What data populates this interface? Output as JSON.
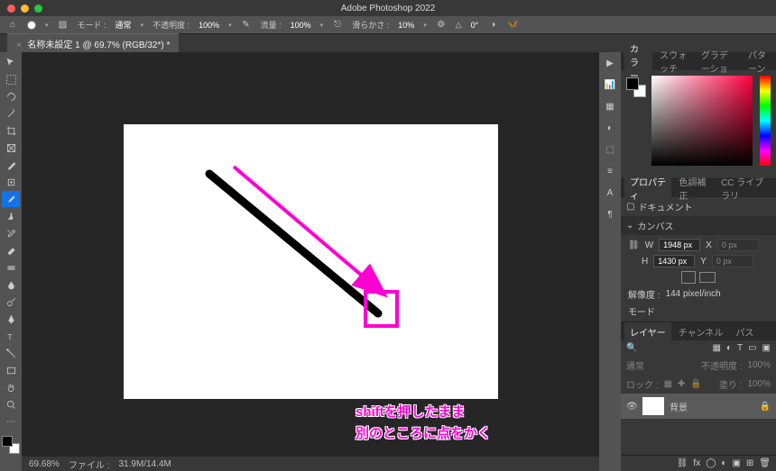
{
  "app": {
    "title": "Adobe Photoshop 2022"
  },
  "tab": {
    "close": "×",
    "name": "名称未設定 1 @ 69.7% (RGB/32*) *"
  },
  "optbar": {
    "home": "⌂",
    "mode_lbl": "モード :",
    "mode_val": "通常",
    "opacity_lbl": "不透明度 :",
    "opacity_val": "100%",
    "flow_lbl": "流量 :",
    "flow_val": "100%",
    "smooth_lbl": "滑らかさ :",
    "smooth_val": "10%",
    "angle_lbl": "△",
    "angle_val": "0°"
  },
  "tools": [
    "move",
    "marquee",
    "lasso",
    "wand",
    "crop",
    "frame",
    "eyedrop",
    "patch",
    "brush",
    "stamp",
    "history",
    "eraser",
    "gradient",
    "blur",
    "dodge",
    "pen",
    "type",
    "path",
    "rect",
    "hand",
    "zoom",
    "more"
  ],
  "rightcol": [
    "arrow",
    "histogram",
    "navigator",
    "adjust",
    "style",
    "align",
    "character",
    "paragraph",
    "more"
  ],
  "color": {
    "tabs": [
      "カラー",
      "スウォッチ",
      "グラデーショ",
      "パターン"
    ]
  },
  "properties": {
    "tabs": [
      "プロパティ",
      "色調補正",
      "CC ライブラリ"
    ],
    "doc_lbl": "ドキュメント",
    "canvas_hdr": "カンバス",
    "w_lbl": "W",
    "w_val": "1948 px",
    "x_lbl": "X",
    "x_val": "0 px",
    "h_lbl": "H",
    "h_val": "1430 px",
    "y_lbl": "Y",
    "y_val": "0 px",
    "res_lbl": "解像度 :",
    "res_val": "144 pixel/inch",
    "mode_lbl": "モード"
  },
  "layers": {
    "tabs": [
      "レイヤー",
      "チャンネル",
      "パス"
    ],
    "blend": "通常",
    "opacity_lbl": "不透明度 :",
    "opacity_val": "100%",
    "lock_lbl": "ロック :",
    "fill_lbl": "塗り :",
    "fill_val": "100%",
    "layer1": "背景",
    "lock_icon": "🔒"
  },
  "status": {
    "zoom": "69.68%",
    "file_lbl": "ファイル :",
    "file_val": "31.9M/14.4M"
  },
  "annotation": {
    "line1": "shiftを押したまま",
    "line2": "別のところに点をかく"
  }
}
